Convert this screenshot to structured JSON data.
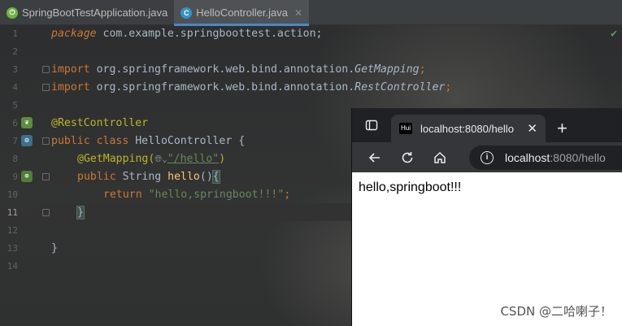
{
  "ide": {
    "tabs": [
      {
        "label": "SpringBootTestApplication.java",
        "icon": "spring-boot-icon"
      },
      {
        "label": "HelloController.java",
        "icon": "class-icon"
      }
    ],
    "line_numbers": [
      "1",
      "2",
      "3",
      "4",
      "5",
      "6",
      "7",
      "8",
      "9",
      "10",
      "11",
      "12",
      "13",
      "14"
    ],
    "current_line": "11",
    "code": {
      "l1_kw": "package",
      "l1_rest": " com.example.springboottest.action;",
      "l3_kw": "import",
      "l3_pkg": " org.springframework.web.bind.annotation.",
      "l3_cls": "GetMapping",
      "l3_end": ";",
      "l4_kw": "import",
      "l4_pkg": " org.springframework.web.bind.annotation.",
      "l4_cls": "RestController",
      "l4_end": ";",
      "l6_ann": "@RestController",
      "l7_kw": "public class",
      "l7_name": " HelloController {",
      "l8_ann": "@GetMapping(",
      "l8_str": "\"/hello\"",
      "l8_end": ")",
      "l9_kw": "public",
      "l9_type": " String ",
      "l9_fn": "hello",
      "l9_paren": "()",
      "l9_brace": "{",
      "l10_kw": "return",
      "l10_str": " \"hello,springboot!!!\"",
      "l10_end": ";",
      "l11": "}",
      "l13": "}"
    }
  },
  "browser": {
    "tab_title": "localhost:8080/hello",
    "favicon_text": "Hui",
    "address_host": "localhost",
    "address_path": ":8080/hello",
    "content": "hello,springboot!!!"
  },
  "watermark": "CSDN @二哈喇子！"
}
